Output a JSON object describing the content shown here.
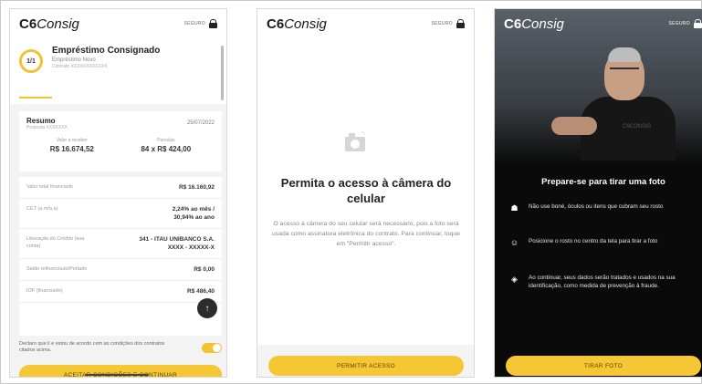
{
  "brand": {
    "logo_bold": "C6",
    "logo_italic": "Consig",
    "secure_label": "SEGURO"
  },
  "colors": {
    "accent": "#f5c735",
    "dark_bg": "#0a0a0a",
    "light_bg": "#f3f3f3"
  },
  "screen1": {
    "step": "1/1",
    "loan_title": "Empréstimo Consignado",
    "loan_subtitle": "Empréstimo Novo",
    "contract": "Contrato XXXXXXXXXXXX",
    "summary_title": "Resumo",
    "proposal": "Proposta XXXXXXX",
    "date": "25/07/2022",
    "receive_label": "Valor a receber",
    "receive_value": "R$ 16.674,52",
    "installments_label": "Parcelas",
    "installments_value": "84 x R$ 424,00",
    "rows": [
      {
        "label": "Valor total financiado",
        "value": "R$ 16.160,92"
      },
      {
        "label": "CET (a.m/a.a)",
        "value": "2,24% ao mês / 30,94% ao ano"
      },
      {
        "label": "Liberação do Crédito (sua conta)",
        "value": "341 - ITAU UNIBANCO S.A. XXXX - XXXXX-X"
      },
      {
        "label": "Saldo refinanciado/Portado",
        "value": "R$ 0,00"
      },
      {
        "label": "IOF (financiado)",
        "value": "R$ 486,40"
      }
    ],
    "agree_text": "Declaro que li e estou de acordo com as condições dos contratos citados acima.",
    "agree_toggle_on": true,
    "button": "ACEITAR CONDIÇÕES E CONTINUAR",
    "fab_icon": "arrow-up-icon"
  },
  "screen2": {
    "camera_icon": "camera-icon",
    "title": "Permita o acesso à câmera do celular",
    "text": "O acesso à câmera do seu celular será necessário, pois a foto será usada como assinatura eletrônica do contrato. Para continuar, toque em \"Permitir acesso\".",
    "button": "PERMITIR ACESSO"
  },
  "screen3": {
    "shirt_logo": "C6CONSIG",
    "title": "Prepare-se para tirar uma foto",
    "tips": [
      {
        "icon": "hat-icon",
        "text": "Não use boné, óculos ou itens que cubram seu rosto"
      },
      {
        "icon": "face-icon",
        "text": "Posicione o rosto no centro da tela para tirar a foto"
      },
      {
        "icon": "shield-icon",
        "text": "Ao continuar, seus dados serão tratados e usados na sua identificação, como medida de prevenção à fraude."
      }
    ],
    "button": "TIRAR FOTO"
  }
}
